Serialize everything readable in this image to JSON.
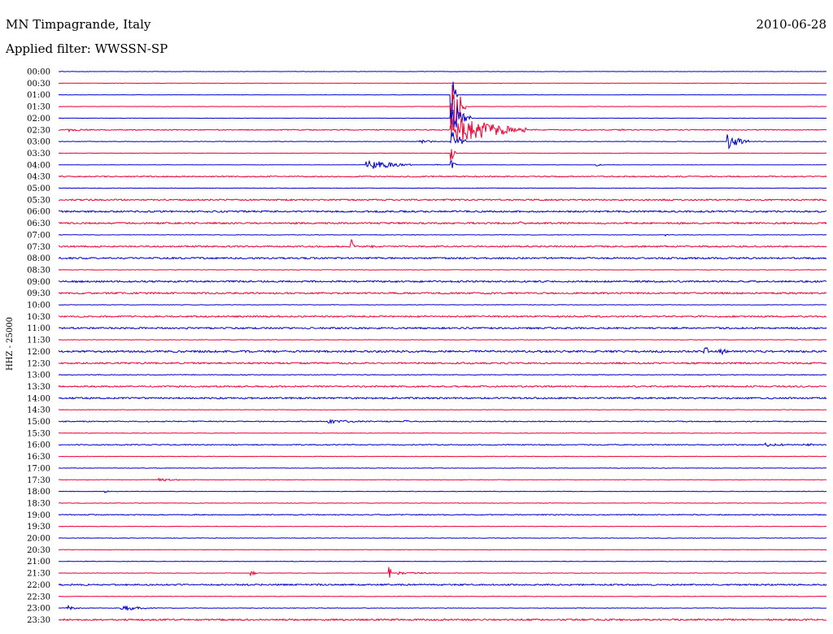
{
  "header": {
    "title": "MN Timpagrande, Italy",
    "date": "2010-06-28",
    "filter": "Applied filter: WWSSN-SP"
  },
  "chart_data": {
    "type": "line",
    "ylabel": "HHZ - 25000",
    "colors": {
      "odd": "#0000cc",
      "even": "#ee0033"
    },
    "rows": [
      "00:00",
      "00:30",
      "01:00",
      "01:30",
      "02:00",
      "02:30",
      "03:00",
      "03:30",
      "04:00",
      "04:30",
      "05:00",
      "05:30",
      "06:00",
      "06:30",
      "07:00",
      "07:30",
      "08:00",
      "08:30",
      "09:00",
      "09:30",
      "10:00",
      "10:30",
      "11:00",
      "11:30",
      "12:00",
      "12:30",
      "13:00",
      "13:30",
      "14:00",
      "14:30",
      "15:00",
      "15:30",
      "16:00",
      "16:30",
      "17:00",
      "17:30",
      "18:00",
      "18:30",
      "19:00",
      "19:30",
      "20:00",
      "20:30",
      "21:00",
      "21:30",
      "22:00",
      "22:30",
      "23:00",
      "23:30"
    ],
    "noise": [
      0.2,
      0.2,
      0.2,
      0.2,
      0.2,
      0.6,
      0.3,
      0.2,
      0.2,
      0.7,
      0.3,
      0.9,
      1.0,
      1.0,
      0.3,
      0.9,
      1.0,
      0.3,
      1.0,
      1.0,
      0.3,
      0.9,
      1.0,
      0.3,
      1.2,
      1.0,
      0.4,
      0.9,
      1.0,
      0.3,
      0.6,
      0.3,
      0.6,
      0.3,
      0.3,
      0.3,
      0.3,
      0.3,
      0.6,
      0.3,
      0.3,
      0.3,
      0.3,
      0.3,
      0.9,
      0.3,
      0.3,
      1.0
    ],
    "events": [
      {
        "row": 2,
        "x": 0.51,
        "amp": 40,
        "dur": 0.01
      },
      {
        "row": 3,
        "x": 0.51,
        "amp": 38,
        "dur": 0.02
      },
      {
        "row": 4,
        "x": 0.51,
        "amp": 20,
        "dur": 0.03
      },
      {
        "row": 5,
        "x": 0.51,
        "amp": 17,
        "dur": 0.1
      },
      {
        "row": 5,
        "x": 0.01,
        "amp": 2,
        "dur": 0.04
      },
      {
        "row": 5,
        "x": 0.73,
        "amp": 1.5,
        "dur": 0.01
      },
      {
        "row": 6,
        "x": 0.51,
        "amp": 16,
        "dur": 0.02
      },
      {
        "row": 6,
        "x": 0.47,
        "amp": 2,
        "dur": 0.03
      },
      {
        "row": 6,
        "x": 0.87,
        "amp": 10,
        "dur": 0.03
      },
      {
        "row": 7,
        "x": 0.51,
        "amp": 10,
        "dur": 0.01
      },
      {
        "row": 8,
        "x": 0.51,
        "amp": 6,
        "dur": 0.01
      },
      {
        "row": 8,
        "x": 0.4,
        "amp": 6,
        "dur": 0.06
      },
      {
        "row": 8,
        "x": 0.49,
        "amp": 1.5,
        "dur": 0.01
      },
      {
        "row": 8,
        "x": 0.7,
        "amp": 1.5,
        "dur": 0.01
      },
      {
        "row": 13,
        "x": 0.6,
        "amp": 2,
        "dur": 0.01
      },
      {
        "row": 14,
        "x": 0.79,
        "amp": 3,
        "dur": 0.005
      },
      {
        "row": 15,
        "x": 0.38,
        "amp": 12,
        "dur": 0.006
      },
      {
        "row": 15,
        "x": 0.39,
        "amp": 1,
        "dur": 0.06
      },
      {
        "row": 24,
        "x": 0.84,
        "amp": 10,
        "dur": 0.008
      },
      {
        "row": 24,
        "x": 0.86,
        "amp": 3,
        "dur": 0.02
      },
      {
        "row": 28,
        "x": 0.15,
        "amp": 2,
        "dur": 0.01
      },
      {
        "row": 30,
        "x": 0.35,
        "amp": 2,
        "dur": 0.06
      },
      {
        "row": 30,
        "x": 0.45,
        "amp": 2,
        "dur": 0.01
      },
      {
        "row": 32,
        "x": 0.92,
        "amp": 2,
        "dur": 0.04
      },
      {
        "row": 32,
        "x": 0.97,
        "amp": 2,
        "dur": 0.02
      },
      {
        "row": 35,
        "x": 0.13,
        "amp": 2,
        "dur": 0.04
      },
      {
        "row": 36,
        "x": 0.06,
        "amp": 2,
        "dur": 0.01
      },
      {
        "row": 43,
        "x": 0.25,
        "amp": 3,
        "dur": 0.01
      },
      {
        "row": 43,
        "x": 0.43,
        "amp": 9,
        "dur": 0.005
      },
      {
        "row": 43,
        "x": 0.44,
        "amp": 1.5,
        "dur": 0.07
      },
      {
        "row": 44,
        "x": 0.66,
        "amp": 3,
        "dur": 0.005
      },
      {
        "row": 46,
        "x": 0.01,
        "amp": 3,
        "dur": 0.02
      },
      {
        "row": 46,
        "x": 0.08,
        "amp": 3,
        "dur": 0.05
      }
    ]
  }
}
